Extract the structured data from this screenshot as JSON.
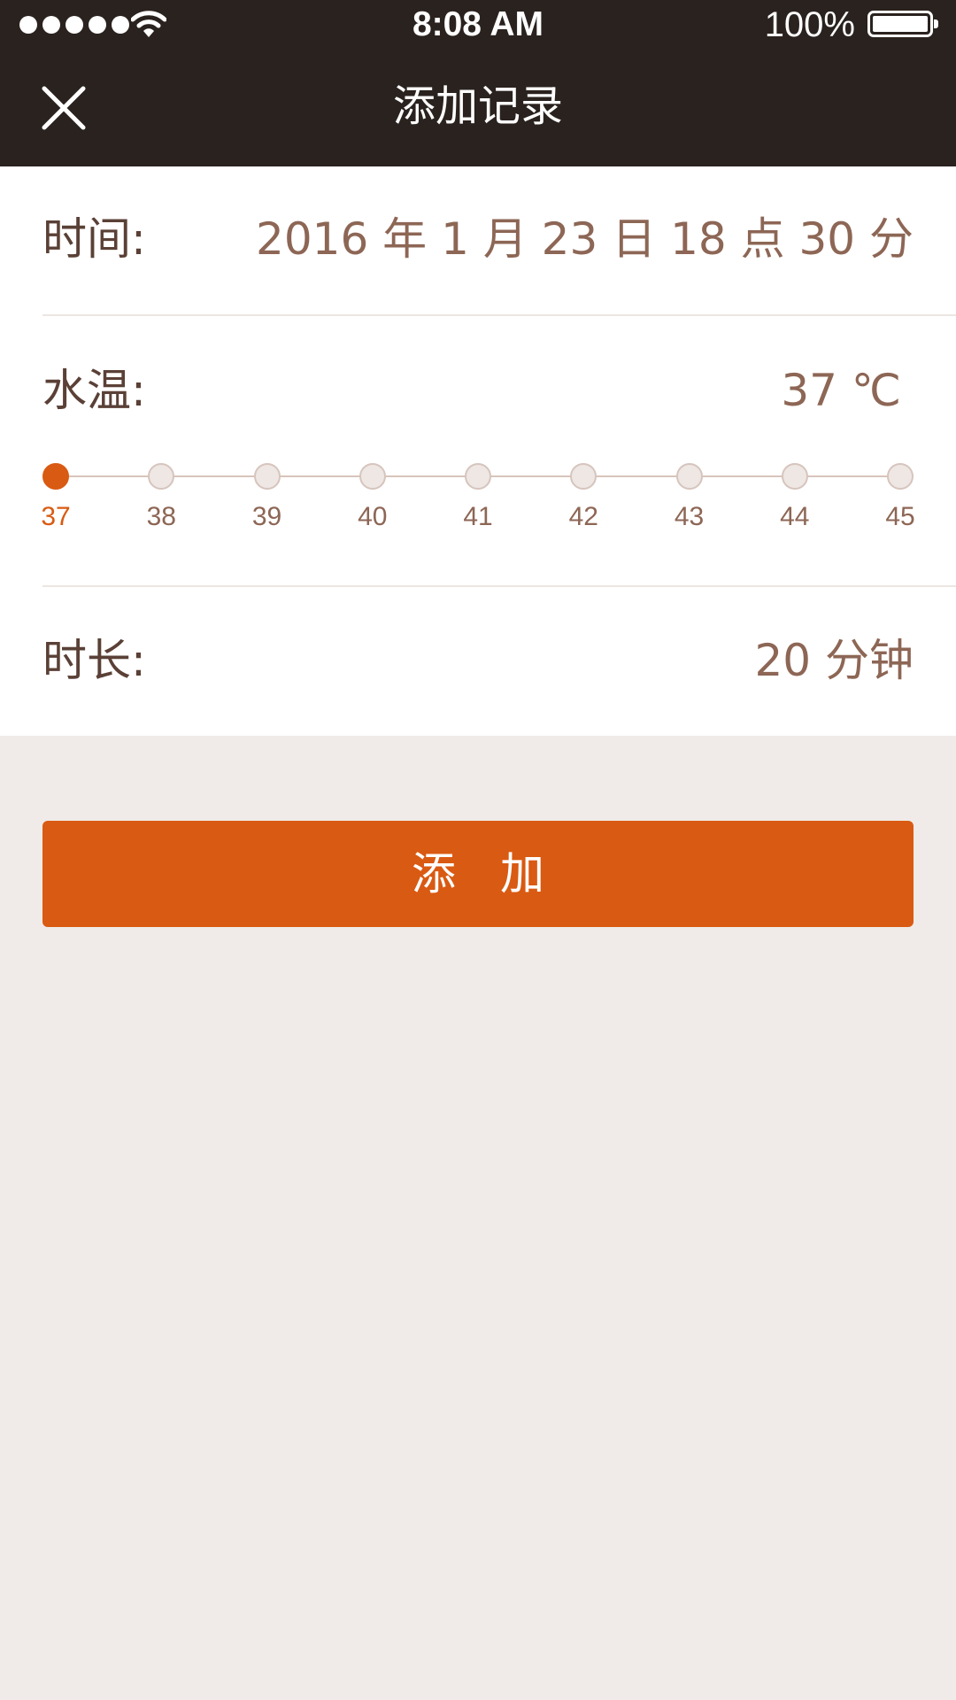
{
  "status_bar": {
    "time": "8:08 AM",
    "battery_percent": "100%",
    "signal_bars": 5,
    "icons": [
      "signal-dots-icon",
      "wifi-icon",
      "battery-icon"
    ]
  },
  "nav": {
    "title": "添加记录",
    "close_icon": "close-icon"
  },
  "form": {
    "time": {
      "label": "时间:",
      "value": "2016 年 1 月 23 日 18 点 30 分"
    },
    "temperature": {
      "label": "水温:",
      "value": "37 ℃",
      "options": [
        "37",
        "38",
        "39",
        "40",
        "41",
        "42",
        "43",
        "44",
        "45"
      ],
      "selected_index": 0
    },
    "duration": {
      "label": "时长:",
      "value": "20 分钟"
    }
  },
  "add_button_label": "添加",
  "colors": {
    "header_bg": "#2a221e",
    "accent": "#d95a12",
    "label_text": "#5a4036",
    "value_text": "#8d6655",
    "page_bg": "#f0ebe8"
  }
}
